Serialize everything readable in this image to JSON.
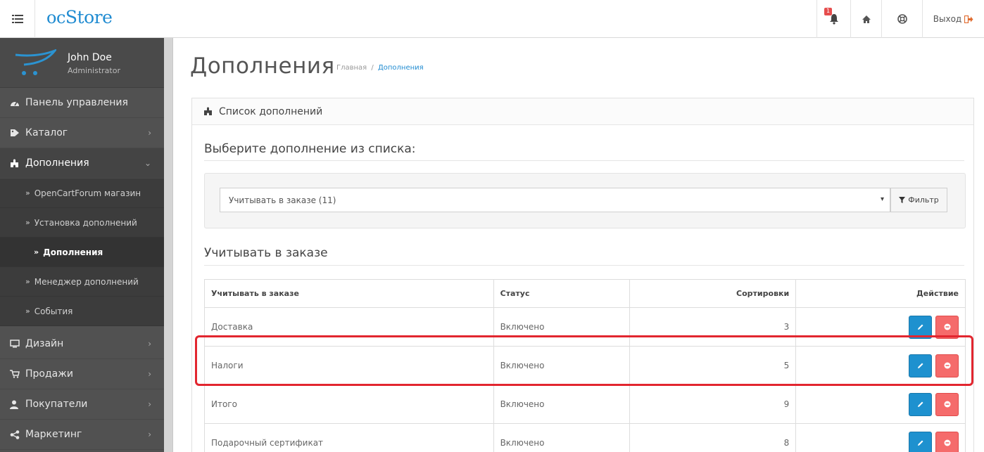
{
  "header": {
    "logo_oc": "oc",
    "logo_store": "Store",
    "notification_count": "1",
    "logout_label": "Выход",
    "colors": {
      "accent": "#1f8bd1",
      "badge": "#e64d4d"
    }
  },
  "profile": {
    "name": "John Doe",
    "role": "Administrator"
  },
  "sidebar": {
    "items": [
      {
        "label": "Панель управления",
        "icon": "dashboard-icon"
      },
      {
        "label": "Каталог",
        "icon": "tag-icon"
      },
      {
        "label": "Дополнения",
        "icon": "puzzle-icon"
      },
      {
        "label": "Дизайн",
        "icon": "monitor-icon"
      },
      {
        "label": "Продажи",
        "icon": "cart-icon"
      },
      {
        "label": "Покупатели",
        "icon": "user-icon"
      },
      {
        "label": "Маркетинг",
        "icon": "share-icon"
      }
    ],
    "sub_items": [
      {
        "label": "OpenCartForum магазин"
      },
      {
        "label": "Установка дополнений"
      },
      {
        "label": "Дополнения"
      },
      {
        "label": "Менеджер дополнений"
      },
      {
        "label": "События"
      }
    ]
  },
  "page": {
    "title": "Дополнения",
    "breadcrumb": [
      "Главная",
      "Дополнения"
    ],
    "breadcrumb_sep": "/"
  },
  "panel": {
    "heading": "Список дополнений",
    "select_heading": "Выберите дополнение из списка:",
    "selected_type": "Учитывать в заказе (11)",
    "filter_label": "Фильтр",
    "section_heading": "Учитывать в заказе"
  },
  "table": {
    "headers": [
      "Учитывать в заказе",
      "Статус",
      "Сортировки",
      "Действие"
    ],
    "rows": [
      {
        "name": "Доставка",
        "status": "Включено",
        "sort": "3"
      },
      {
        "name": "Налоги",
        "status": "Включено",
        "sort": "5"
      },
      {
        "name": "Итого",
        "status": "Включено",
        "sort": "9"
      },
      {
        "name": "Подарочный сертификат",
        "status": "Включено",
        "sort": "8"
      }
    ]
  },
  "colors": {
    "edit": "#1e91cf",
    "delete": "#f56b6b",
    "highlight": "#e2262f",
    "sidebar": "#515151"
  }
}
